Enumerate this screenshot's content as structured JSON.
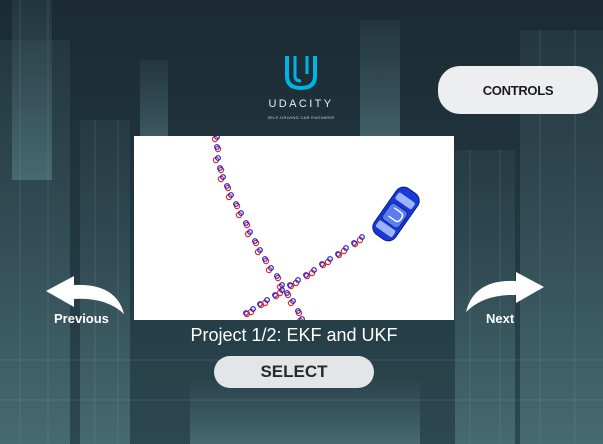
{
  "brand": {
    "name": "UDACITY",
    "subtitle": "SELF-DRIVING CAR ENGINEER",
    "logo_color": "#02b3e4"
  },
  "controls_button": {
    "label": "CONTROLS"
  },
  "navigation": {
    "previous_label": "Previous",
    "next_label": "Next"
  },
  "project": {
    "title": "Project 1/2: EKF and UKF"
  },
  "select_button": {
    "label": "SELECT"
  },
  "colors": {
    "background": "#1f3038",
    "button_bg": "#eceeef",
    "measurement_marker": "#e8261f",
    "estimate_marker": "#1a1adb",
    "car": "#1838d8"
  },
  "icons": {
    "previous": "curved-arrow-left-icon",
    "next": "curved-arrow-right-icon",
    "logo": "udacity-u-logo-icon",
    "car": "car-icon"
  }
}
